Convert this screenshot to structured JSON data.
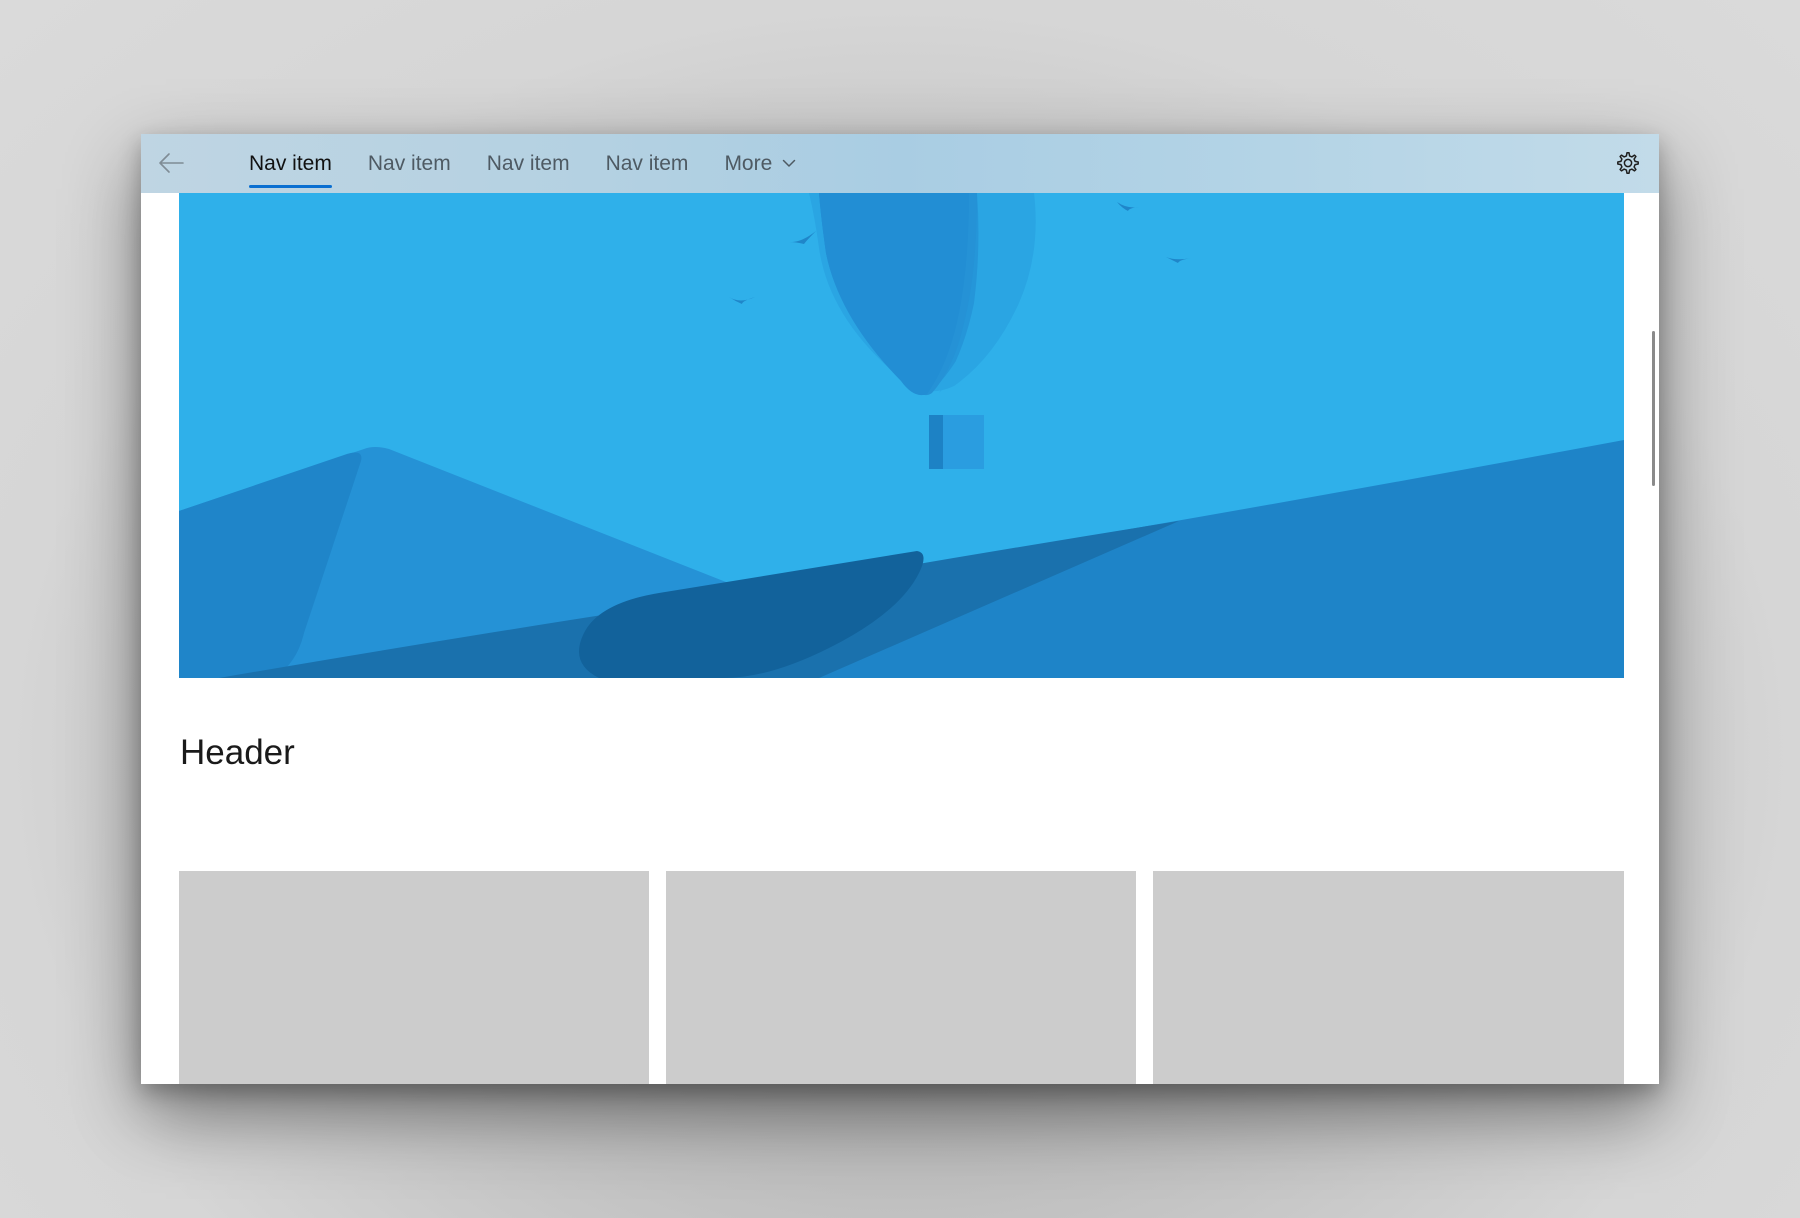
{
  "nav": {
    "items": [
      {
        "label": "Nav item",
        "selected": true
      },
      {
        "label": "Nav item",
        "selected": false
      },
      {
        "label": "Nav item",
        "selected": false
      },
      {
        "label": "Nav item",
        "selected": false
      }
    ],
    "more_label": "More"
  },
  "content": {
    "header": "Header"
  },
  "icons": {
    "back": "back-arrow-icon",
    "more": "chevron-down-icon",
    "settings": "gear-icon"
  },
  "colors": {
    "accent": "#0a6fd1",
    "sky": "#2fb0ea",
    "tile": "#cccccc"
  }
}
